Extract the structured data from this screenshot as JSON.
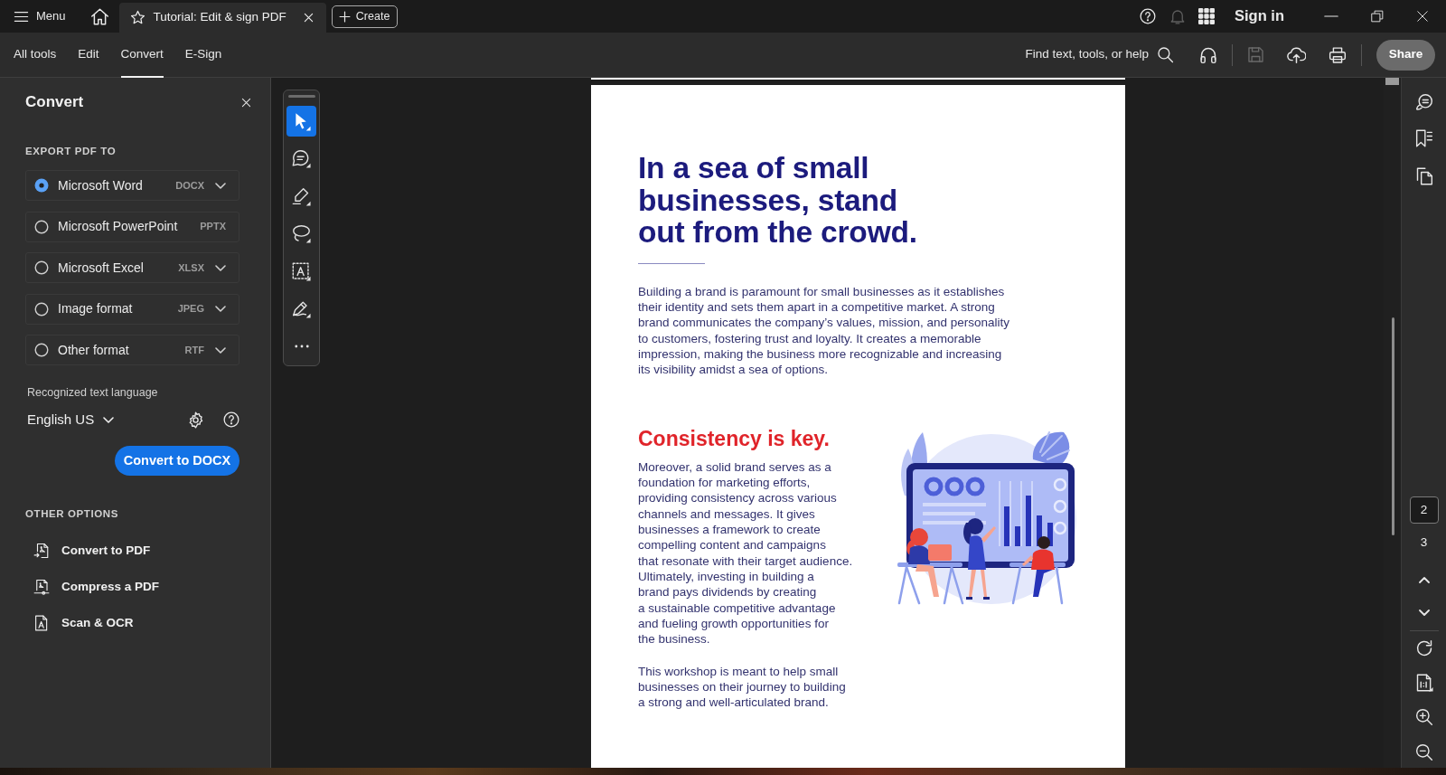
{
  "title_bar": {
    "menu_label": "Menu",
    "tabs": [
      {
        "label": "Tutorial: Edit & sign PDF",
        "selected": true
      }
    ],
    "create_label": "Create",
    "notifications": {
      "disabled": true
    },
    "sign_in_label": "Sign in"
  },
  "toolbar": {
    "tabs": [
      {
        "label": "All tools",
        "selected": false
      },
      {
        "label": "Edit",
        "selected": false
      },
      {
        "label": "Convert",
        "selected": true
      },
      {
        "label": "E-Sign",
        "selected": false
      }
    ],
    "search_label": "Find text, tools, or help",
    "save": {
      "disabled": true
    },
    "share_label": "Share"
  },
  "convert_panel": {
    "title": "Convert",
    "export_heading": "EXPORT PDF TO",
    "formats": [
      {
        "label": "Microsoft Word",
        "extension": "DOCX",
        "selected": true,
        "dropdown": true
      },
      {
        "label": "Microsoft PowerPoint",
        "extension": "PPTX",
        "selected": false,
        "dropdown": false
      },
      {
        "label": "Microsoft Excel",
        "extension": "XLSX",
        "selected": false,
        "dropdown": true
      },
      {
        "label": "Image format",
        "extension": "JPEG",
        "selected": false,
        "dropdown": true
      },
      {
        "label": "Other format",
        "extension": "RTF",
        "selected": false,
        "dropdown": true
      }
    ],
    "language_label": "Recognized text language",
    "language": "English US",
    "convert_button": "Convert to DOCX",
    "other_heading": "OTHER OPTIONS",
    "other_options": [
      {
        "label": "Convert to PDF"
      },
      {
        "label": "Compress a PDF"
      },
      {
        "label": "Scan & OCR"
      }
    ]
  },
  "tool_palette": {
    "tools": [
      {
        "selected": true
      },
      {
        "selected": false
      },
      {
        "selected": false
      },
      {
        "selected": false
      },
      {
        "selected": false
      },
      {
        "selected": false
      }
    ]
  },
  "document": {
    "heading": "In a sea of small\nbusinesses, stand\nout from the crowd.",
    "intro": "Building a brand is paramount for small businesses as it establishes\ntheir identity and sets them apart in a competitive market. A strong\nbrand communicates the company’s values, mission, and personality\nto customers, fostering trust and loyalty. It creates a memorable\nimpression, making the business more recognizable and increasing\nits visibility amidst a sea of options.",
    "section_title": "Consistency is key.",
    "section_body": "Moreover, a solid brand serves as a\nfoundation for marketing efforts,\nproviding consistency across various\nchannels and messages. It gives\nbusinesses a framework to create\ncompelling content and campaigns\nthat resonate with their target audience.\nUltimately, investing in building a\nbrand pays dividends by creating\na sustainable competitive advantage\nand fueling growth opportunities for\nthe business.",
    "closing": "This workshop is meant to help small\nbusinesses on their journey to building\na strong and well-articulated brand."
  },
  "page_navigator": {
    "pages": [
      {
        "label": "2",
        "selected": true
      },
      {
        "label": "3",
        "selected": false
      }
    ]
  }
}
